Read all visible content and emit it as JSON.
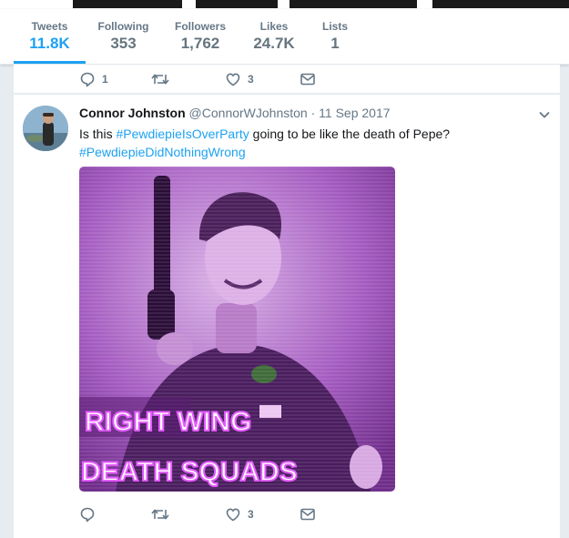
{
  "profile_nav": {
    "stats": [
      {
        "label": "Tweets",
        "value": "11.8K"
      },
      {
        "label": "Following",
        "value": "353"
      },
      {
        "label": "Followers",
        "value": "1,762"
      },
      {
        "label": "Likes",
        "value": "24.7K"
      },
      {
        "label": "Lists",
        "value": "1"
      }
    ],
    "active_tab": "Tweets"
  },
  "previous_tweet": {
    "reply_count": "1",
    "retweet_count": "",
    "like_count": "3"
  },
  "tweet": {
    "author_name": "Connor Johnston",
    "author_handle": "@ConnorWJohnston",
    "separator": "·",
    "timestamp": "11 Sep 2017",
    "text_before": "Is this ",
    "hashtag_1": "#PewdiepieIsOverParty",
    "text_after": " going to be like the death of Pepe?",
    "hashtag_2": "#PewdiepieDidNothingWrong",
    "media": {
      "caption_line_1": "RIGHT WING",
      "caption_line_2": "DEATH SQUADS"
    },
    "reply_count": "",
    "retweet_count": "",
    "like_count": "3"
  },
  "icons": {
    "reply": "speech-bubble-icon",
    "retweet": "retweet-arrows-icon",
    "like": "heart-outline-icon",
    "message": "envelope-icon",
    "more": "chevron-down-icon"
  },
  "colors": {
    "accent": "#1da1f2",
    "icon_gray": "#657786",
    "image_tint": "#9b3fb5"
  }
}
